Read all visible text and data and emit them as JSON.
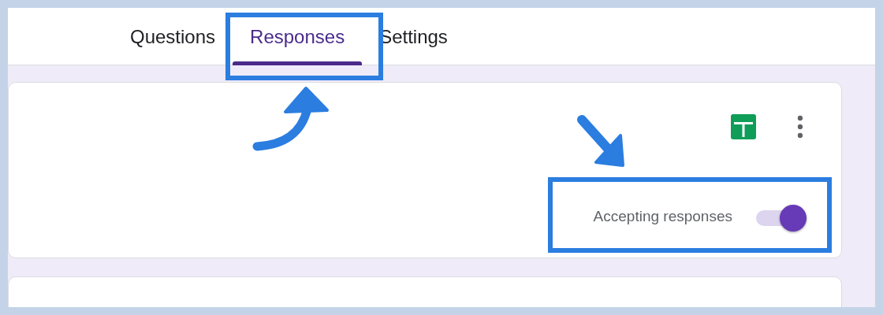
{
  "tabs": [
    {
      "label": "Questions",
      "selected": false
    },
    {
      "label": "Responses",
      "selected": true
    },
    {
      "label": "Settings",
      "selected": false
    }
  ],
  "accepting_responses": {
    "label": "Accepting responses",
    "on": true
  }
}
